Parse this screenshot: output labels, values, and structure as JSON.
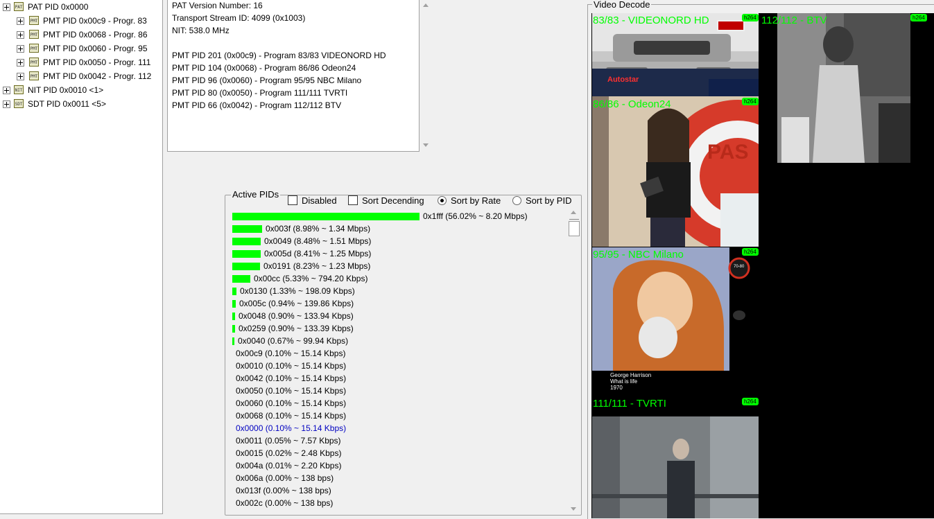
{
  "tree": {
    "items": [
      {
        "label": "PAT PID 0x0000",
        "icon": "PAT"
      },
      {
        "label": "PMT PID 0x00c9 - Progr. 83",
        "icon": "PMT"
      },
      {
        "label": "PMT PID 0x0068 - Progr. 86",
        "icon": "PMT"
      },
      {
        "label": "PMT PID 0x0060 - Progr. 95",
        "icon": "PMT"
      },
      {
        "label": "PMT PID 0x0050 - Progr. 111",
        "icon": "PMT"
      },
      {
        "label": "PMT PID 0x0042 - Progr. 112",
        "icon": "PMT"
      },
      {
        "label": "NIT PID 0x0010 <1>",
        "icon": "NIT"
      },
      {
        "label": "SDT PID 0x0011 <5>",
        "icon": "SDT"
      }
    ]
  },
  "pat": {
    "lines": [
      "PAT Version Number: 16",
      "Transport Stream ID: 4099 (0x1003)",
      "NIT: 538.0 MHz",
      "",
      "PMT PID 201 (0x00c9) - Program 83/83 VIDEONORD HD",
      "PMT PID 104 (0x0068) - Program 86/86 Odeon24",
      "PMT PID 96 (0x0060) - Program 95/95 NBC Milano",
      "PMT PID 80 (0x0050) - Program 111/111 TVRTI",
      "PMT PID 66 (0x0042) - Program 112/112 BTV"
    ]
  },
  "active_pids": {
    "title": "Active PIDs",
    "options": {
      "disabled": "Disabled",
      "sort_desc": "Sort Decending",
      "sort_rate": "Sort by Rate",
      "sort_pid": "Sort by PID"
    },
    "sort_mode": "rate",
    "rows": [
      {
        "text": "0x1fff (56.02% ~ 8.20 Mbps)",
        "share": 56.02
      },
      {
        "text": "0x003f (8.98% ~ 1.34 Mbps)",
        "share": 8.98
      },
      {
        "text": "0x0049 (8.48% ~ 1.51 Mbps)",
        "share": 8.48
      },
      {
        "text": "0x005d (8.41% ~ 1.25 Mbps)",
        "share": 8.41
      },
      {
        "text": "0x0191 (8.23% ~ 1.23 Mbps)",
        "share": 8.23
      },
      {
        "text": "0x00cc (5.33% ~ 794.20 Kbps)",
        "share": 5.33
      },
      {
        "text": "0x0130 (1.33% ~ 198.09 Kbps)",
        "share": 1.33
      },
      {
        "text": "0x005c (0.94% ~ 139.86 Kbps)",
        "share": 0.94
      },
      {
        "text": "0x0048 (0.90% ~ 133.94 Kbps)",
        "share": 0.9
      },
      {
        "text": "0x0259 (0.90% ~ 133.39 Kbps)",
        "share": 0.9
      },
      {
        "text": "0x0040 (0.67% ~ 99.94 Kbps)",
        "share": 0.67
      },
      {
        "text": "0x00c9 (0.10% ~ 15.14 Kbps)",
        "share": 0.1
      },
      {
        "text": "0x0010 (0.10% ~ 15.14 Kbps)",
        "share": 0.1
      },
      {
        "text": "0x0042 (0.10% ~ 15.14 Kbps)",
        "share": 0.1
      },
      {
        "text": "0x0050 (0.10% ~ 15.14 Kbps)",
        "share": 0.1
      },
      {
        "text": "0x0060 (0.10% ~ 15.14 Kbps)",
        "share": 0.1
      },
      {
        "text": "0x0068 (0.10% ~ 15.14 Kbps)",
        "share": 0.1
      },
      {
        "text": "0x0000 (0.10% ~ 15.14 Kbps)",
        "share": 0.1,
        "selected": true
      },
      {
        "text": "0x0011 (0.05% ~ 7.57 Kbps)",
        "share": 0.05
      },
      {
        "text": "0x0015 (0.02% ~ 2.48 Kbps)",
        "share": 0.02
      },
      {
        "text": "0x004a (0.01% ~ 2.20 Kbps)",
        "share": 0.01
      },
      {
        "text": "0x006a (0.00% ~ 138 bps)",
        "share": 0.0
      },
      {
        "text": "0x013f (0.00% ~ 138 bps)",
        "share": 0.0
      },
      {
        "text": "0x002c (0.00% ~ 138 bps)",
        "share": 0.0
      }
    ]
  },
  "video": {
    "title": "Video Decode",
    "codec_badge": "h264",
    "tiles": [
      {
        "title": "83/83 - VIDEONORD HD"
      },
      {
        "title": "112/112 - BTV"
      },
      {
        "title": "86/86 - Odeon24"
      },
      {
        "title": "95/95 - NBC Milano"
      },
      {
        "title": "111/111 - TVRTI"
      }
    ],
    "overlay_texts": {
      "autostar": "Autostar",
      "odeon_wall": "PAS",
      "nbc_caption_1": "George Harrison",
      "nbc_caption_2": "What is life",
      "nbc_caption_3": "1970",
      "nbc_logo": "70-80"
    }
  },
  "colors": {
    "accent": "#00ff00",
    "selected_text": "#0000c0",
    "panel_bg": "#f0f0f0"
  }
}
